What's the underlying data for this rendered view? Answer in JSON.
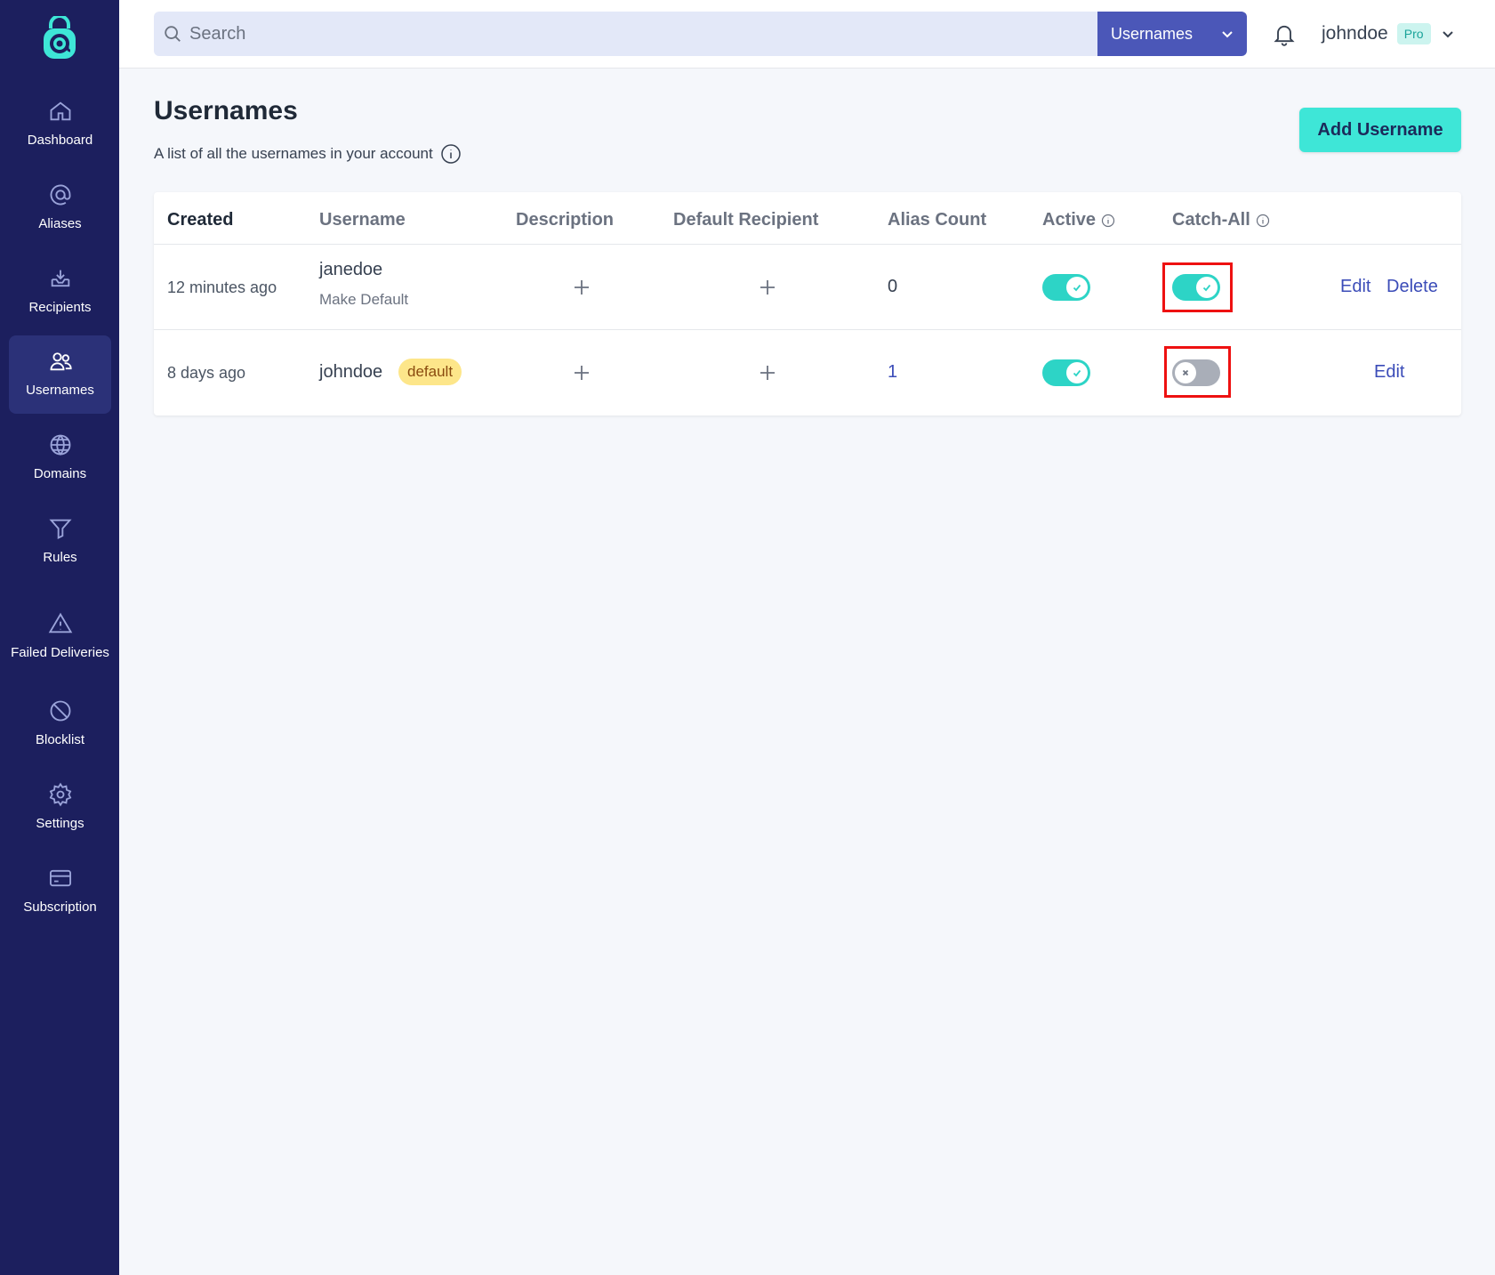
{
  "app": {
    "colors": {
      "sidebar": "#1c1f5e",
      "accent": "#3ee6d7",
      "link": "#3b4cb8",
      "highlight": "#ee1111"
    }
  },
  "sidebar": {
    "items": [
      {
        "label": "Dashboard",
        "icon": "home-icon"
      },
      {
        "label": "Aliases",
        "icon": "at-sign-icon"
      },
      {
        "label": "Recipients",
        "icon": "inbox-icon"
      },
      {
        "label": "Usernames",
        "icon": "users-icon",
        "active": true
      },
      {
        "label": "Domains",
        "icon": "globe-icon"
      },
      {
        "label": "Rules",
        "icon": "funnel-icon"
      },
      {
        "label": "Failed Deliveries",
        "icon": "warning-icon"
      },
      {
        "label": "Blocklist",
        "icon": "ban-icon"
      },
      {
        "label": "Settings",
        "icon": "gear-icon"
      },
      {
        "label": "Subscription",
        "icon": "credit-card-icon"
      }
    ]
  },
  "topbar": {
    "search_placeholder": "Search",
    "search_scope": "Usernames",
    "user": "johndoe",
    "plan_badge": "Pro"
  },
  "page": {
    "title": "Usernames",
    "subtitle": "A list of all the usernames in your account",
    "add_button": "Add Username"
  },
  "table": {
    "headers": [
      "Created",
      "Username",
      "Description",
      "Default Recipient",
      "Alias Count",
      "Active",
      "Catch-All"
    ],
    "rows": [
      {
        "created": "12 minutes ago",
        "username": "janedoe",
        "make_default": "Make Default",
        "alias_count": "0",
        "active": true,
        "catch_all": true,
        "actions": [
          "Edit",
          "Delete"
        ]
      },
      {
        "created": "8 days ago",
        "username": "johndoe",
        "badge": "default",
        "alias_count": "1",
        "active": true,
        "catch_all": false,
        "actions": [
          "Edit"
        ]
      }
    ]
  }
}
